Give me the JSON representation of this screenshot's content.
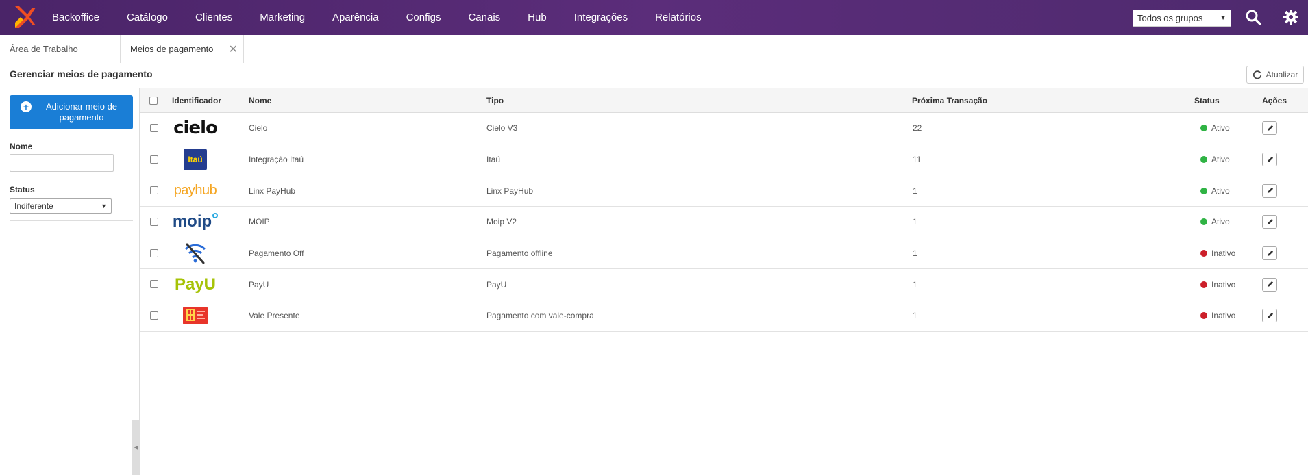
{
  "topbar": {
    "nav": [
      "Backoffice",
      "Catálogo",
      "Clientes",
      "Marketing",
      "Aparência",
      "Configs",
      "Canais",
      "Hub",
      "Integrações",
      "Relatórios"
    ],
    "group_select": "Todos os grupos",
    "brand_color": "#4e2a6e"
  },
  "tabs": {
    "home": "Área de Trabalho",
    "active": "Meios de pagamento"
  },
  "page": {
    "title": "Gerenciar meios de pagamento",
    "refresh_label": "Atualizar"
  },
  "sidebar": {
    "add_button": "Adicionar meio de pagamento",
    "name_label": "Nome",
    "name_value": "",
    "status_label": "Status",
    "status_value": "Indiferente"
  },
  "table": {
    "headers": {
      "identifier": "Identificador",
      "name": "Nome",
      "type": "Tipo",
      "next_transaction": "Próxima Transação",
      "status": "Status",
      "actions": "Ações"
    },
    "rows": [
      {
        "logo": "cielo-logo",
        "name": "Cielo",
        "type": "Cielo V3",
        "next": "22",
        "status": "Ativo",
        "active": true
      },
      {
        "logo": "itau-logo",
        "name": "Integração Itaú",
        "type": "Itaú",
        "next": "11",
        "status": "Ativo",
        "active": true
      },
      {
        "logo": "payhub-logo",
        "name": "Linx PayHub",
        "type": "Linx PayHub",
        "next": "1",
        "status": "Ativo",
        "active": true
      },
      {
        "logo": "moip-logo",
        "name": "MOIP",
        "type": "Moip V2",
        "next": "1",
        "status": "Ativo",
        "active": true
      },
      {
        "logo": "offline-logo",
        "name": "Pagamento Off",
        "type": "Pagamento offline",
        "next": "1",
        "status": "Inativo",
        "active": false
      },
      {
        "logo": "payu-logo",
        "name": "PayU",
        "type": "PayU",
        "next": "1",
        "status": "Inativo",
        "active": false
      },
      {
        "logo": "gift-card-logo",
        "name": "Vale Presente",
        "type": "Pagamento com vale-compra",
        "next": "1",
        "status": "Inativo",
        "active": false
      }
    ],
    "status_colors": {
      "active": "#2fb344",
      "inactive": "#cc1f2a"
    }
  },
  "logo_text": {
    "cielo": "cielo",
    "itau": "Itaú",
    "payhub": "payhub",
    "moip": "moip",
    "payu": "PayU"
  }
}
